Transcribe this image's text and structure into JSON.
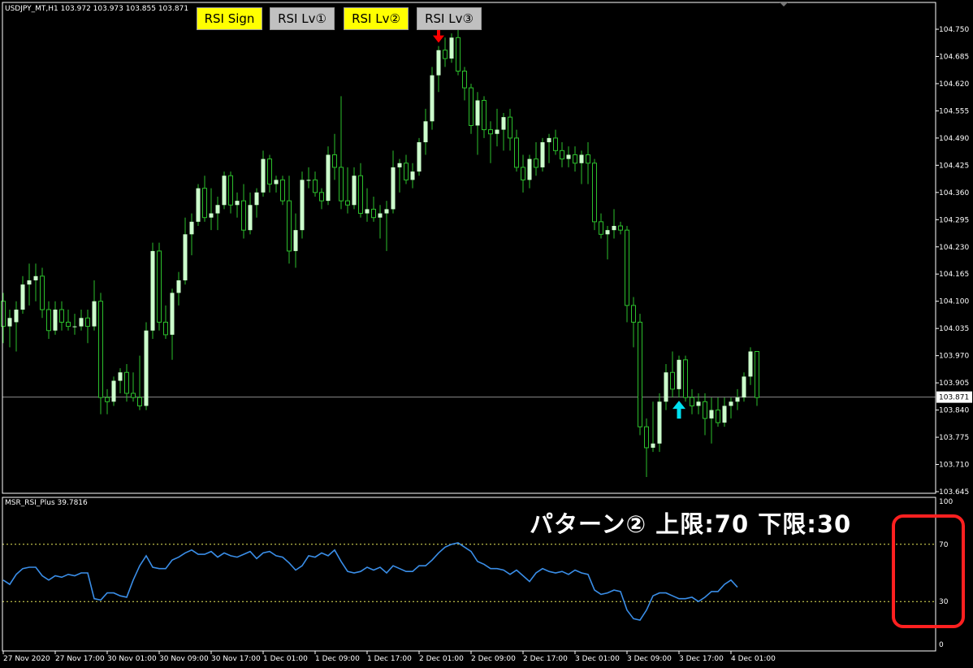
{
  "symbol_line": "USDJPY_MT,H1  103.972 103.973 103.855 103.871",
  "rsi_label": "MSR_RSI_Plus 39.7816",
  "pattern_text": "パターン②  上限:70  下限:30",
  "buttons": [
    {
      "label": "RSI Sign",
      "color": "#ffff00"
    },
    {
      "label": "RSI Lv①",
      "color": "#c0c0c0"
    },
    {
      "label": "RSI Lv②",
      "color": "#ffff00"
    },
    {
      "label": "RSI Lv③",
      "color": "#c0c0c0"
    }
  ],
  "colors": {
    "candle": "#ccffcc",
    "wick": "#2cc02c",
    "rsi_line": "#3a8ee8",
    "level_line": "#e8e85a",
    "down_arrow": "#ff0000",
    "up_arrow": "#00e0f0",
    "highlight_box": "#ff2020"
  },
  "chart_data": [
    {
      "type": "candlestick",
      "title": "USDJPY_MT,H1",
      "current_price": "103.871",
      "price_ticks": [
        "104.750",
        "104.685",
        "104.620",
        "104.555",
        "104.490",
        "104.425",
        "104.360",
        "104.295",
        "104.230",
        "104.165",
        "104.100",
        "104.035",
        "103.970",
        "103.905",
        "103.840",
        "103.775",
        "103.710",
        "103.645"
      ],
      "ylim": [
        103.645,
        104.75
      ],
      "ohlc": [
        [
          104.1,
          104.12,
          104.0,
          104.04
        ],
        [
          104.04,
          104.08,
          103.99,
          104.06
        ],
        [
          104.05,
          104.1,
          103.98,
          104.08
        ],
        [
          104.08,
          104.16,
          104.07,
          104.14
        ],
        [
          104.14,
          104.19,
          104.09,
          104.15
        ],
        [
          104.15,
          104.19,
          104.1,
          104.16
        ],
        [
          104.16,
          104.18,
          104.06,
          104.08
        ],
        [
          104.08,
          104.1,
          104.01,
          104.03
        ],
        [
          104.03,
          104.1,
          104.02,
          104.08
        ],
        [
          104.08,
          104.1,
          104.03,
          104.05
        ],
        [
          104.05,
          104.08,
          104.03,
          104.04
        ],
        [
          104.04,
          104.07,
          104.02,
          104.04
        ],
        [
          104.04,
          104.08,
          104.03,
          104.06
        ],
        [
          104.06,
          104.08,
          104.0,
          104.04
        ],
        [
          104.04,
          104.15,
          104.03,
          104.1
        ],
        [
          104.1,
          104.12,
          103.83,
          103.87
        ],
        [
          103.87,
          103.89,
          103.83,
          103.86
        ],
        [
          103.86,
          103.92,
          103.85,
          103.91
        ],
        [
          103.91,
          103.94,
          103.88,
          103.93
        ],
        [
          103.93,
          103.95,
          103.86,
          103.88
        ],
        [
          103.88,
          103.93,
          103.86,
          103.87
        ],
        [
          103.87,
          103.97,
          103.84,
          103.85
        ],
        [
          103.85,
          104.05,
          103.84,
          104.03
        ],
        [
          104.03,
          104.24,
          104.01,
          104.22
        ],
        [
          104.22,
          104.24,
          104.03,
          104.05
        ],
        [
          104.05,
          104.09,
          104.01,
          104.02
        ],
        [
          104.02,
          104.13,
          103.96,
          104.12
        ],
        [
          104.12,
          104.17,
          104.09,
          104.15
        ],
        [
          104.15,
          104.3,
          104.14,
          104.26
        ],
        [
          104.26,
          104.31,
          104.21,
          104.29
        ],
        [
          104.29,
          104.38,
          104.28,
          104.37
        ],
        [
          104.37,
          104.4,
          104.29,
          104.3
        ],
        [
          104.3,
          104.37,
          104.27,
          104.31
        ],
        [
          104.31,
          104.35,
          104.27,
          104.33
        ],
        [
          104.33,
          104.41,
          104.32,
          104.4
        ],
        [
          104.4,
          104.41,
          104.31,
          104.33
        ],
        [
          104.33,
          104.36,
          104.3,
          104.34
        ],
        [
          104.34,
          104.38,
          104.25,
          104.27
        ],
        [
          104.27,
          104.36,
          104.26,
          104.33
        ],
        [
          104.33,
          104.37,
          104.3,
          104.36
        ],
        [
          104.36,
          104.46,
          104.35,
          104.44
        ],
        [
          104.44,
          104.45,
          104.36,
          104.38
        ],
        [
          104.38,
          104.4,
          104.36,
          104.39
        ],
        [
          104.39,
          104.4,
          104.33,
          104.34
        ],
        [
          104.34,
          104.4,
          104.19,
          104.22
        ],
        [
          104.22,
          104.31,
          104.18,
          104.27
        ],
        [
          104.27,
          104.41,
          104.25,
          104.39
        ],
        [
          104.39,
          104.42,
          104.37,
          104.39
        ],
        [
          104.39,
          104.41,
          104.35,
          104.36
        ],
        [
          104.36,
          104.37,
          104.32,
          104.34
        ],
        [
          104.34,
          104.47,
          104.33,
          104.45
        ],
        [
          104.45,
          104.5,
          104.39,
          104.42
        ],
        [
          104.42,
          104.59,
          104.32,
          104.34
        ],
        [
          104.34,
          104.42,
          104.31,
          104.33
        ],
        [
          104.33,
          104.42,
          104.32,
          104.4
        ],
        [
          104.4,
          104.43,
          104.3,
          104.31
        ],
        [
          104.31,
          104.37,
          104.29,
          104.32
        ],
        [
          104.32,
          104.35,
          104.29,
          104.3
        ],
        [
          104.3,
          104.33,
          104.25,
          104.31
        ],
        [
          104.31,
          104.34,
          104.22,
          104.32
        ],
        [
          104.32,
          104.46,
          104.31,
          104.42
        ],
        [
          104.42,
          104.44,
          104.36,
          104.43
        ],
        [
          104.43,
          104.45,
          104.38,
          104.39
        ],
        [
          104.39,
          104.43,
          104.37,
          104.41
        ],
        [
          104.41,
          104.49,
          104.4,
          104.48
        ],
        [
          104.48,
          104.56,
          104.45,
          104.53
        ],
        [
          104.53,
          104.66,
          104.51,
          104.64
        ],
        [
          104.64,
          104.71,
          104.6,
          104.7
        ],
        [
          104.7,
          104.73,
          104.66,
          104.68
        ],
        [
          104.68,
          104.74,
          104.67,
          104.73
        ],
        [
          104.73,
          104.75,
          104.64,
          104.65
        ],
        [
          104.65,
          104.66,
          104.58,
          104.61
        ],
        [
          104.61,
          104.62,
          104.5,
          104.52
        ],
        [
          104.52,
          104.6,
          104.45,
          104.58
        ],
        [
          104.58,
          104.59,
          104.49,
          104.51
        ],
        [
          104.51,
          104.53,
          104.43,
          104.5
        ],
        [
          104.5,
          104.56,
          104.47,
          104.51
        ],
        [
          104.51,
          104.55,
          104.46,
          104.54
        ],
        [
          104.54,
          104.56,
          104.46,
          104.49
        ],
        [
          104.49,
          104.51,
          104.41,
          104.42
        ],
        [
          104.42,
          104.45,
          104.36,
          104.39
        ],
        [
          104.39,
          104.45,
          104.37,
          104.44
        ],
        [
          104.44,
          104.48,
          104.4,
          104.42
        ],
        [
          104.42,
          104.49,
          104.41,
          104.48
        ],
        [
          104.48,
          104.5,
          104.43,
          104.49
        ],
        [
          104.49,
          104.51,
          104.45,
          104.46
        ],
        [
          104.46,
          104.48,
          104.42,
          104.44
        ],
        [
          104.44,
          104.47,
          104.42,
          104.45
        ],
        [
          104.45,
          104.47,
          104.41,
          104.43
        ],
        [
          104.43,
          104.46,
          104.38,
          104.45
        ],
        [
          104.45,
          104.48,
          104.38,
          104.43
        ],
        [
          104.43,
          104.44,
          104.27,
          104.29
        ],
        [
          104.29,
          104.31,
          104.25,
          104.26
        ],
        [
          104.26,
          104.28,
          104.2,
          104.27
        ],
        [
          104.27,
          104.32,
          104.25,
          104.28
        ],
        [
          104.28,
          104.29,
          104.26,
          104.27
        ],
        [
          104.27,
          104.28,
          104.05,
          104.09
        ],
        [
          104.09,
          104.11,
          103.99,
          104.05
        ],
        [
          104.05,
          104.07,
          103.78,
          103.8
        ],
        [
          103.8,
          103.82,
          103.68,
          103.75
        ],
        [
          103.75,
          103.86,
          103.74,
          103.76
        ],
        [
          103.76,
          103.88,
          103.74,
          103.86
        ],
        [
          103.86,
          103.95,
          103.84,
          103.93
        ],
        [
          103.93,
          103.98,
          103.87,
          103.89
        ],
        [
          103.89,
          103.97,
          103.87,
          103.96
        ],
        [
          103.96,
          103.97,
          103.86,
          103.87
        ],
        [
          103.87,
          103.89,
          103.83,
          103.85
        ],
        [
          103.85,
          103.88,
          103.83,
          103.86
        ],
        [
          103.86,
          103.88,
          103.78,
          103.82
        ],
        [
          103.82,
          103.87,
          103.76,
          103.84
        ],
        [
          103.84,
          103.87,
          103.8,
          103.81
        ],
        [
          103.81,
          103.87,
          103.8,
          103.85
        ],
        [
          103.85,
          103.87,
          103.82,
          103.86
        ],
        [
          103.86,
          103.89,
          103.84,
          103.87
        ],
        [
          103.87,
          103.93,
          103.86,
          103.92
        ],
        [
          103.92,
          103.99,
          103.9,
          103.98
        ],
        [
          103.98,
          103.98,
          103.85,
          103.87
        ]
      ],
      "signals": [
        {
          "type": "down",
          "bar": 67
        },
        {
          "type": "down",
          "bar": 69
        },
        {
          "type": "up",
          "bar": 104
        }
      ],
      "x_ticks": [
        {
          "label": "27 Nov 2020",
          "bar": 0
        },
        {
          "label": "27 Nov 17:00",
          "bar": 8
        },
        {
          "label": "30 Nov 01:00",
          "bar": 16
        },
        {
          "label": "30 Nov 09:00",
          "bar": 24
        },
        {
          "label": "30 Nov 17:00",
          "bar": 32
        },
        {
          "label": "1 Dec 01:00",
          "bar": 40
        },
        {
          "label": "1 Dec 09:00",
          "bar": 48
        },
        {
          "label": "1 Dec 17:00",
          "bar": 56
        },
        {
          "label": "2 Dec 01:00",
          "bar": 64
        },
        {
          "label": "2 Dec 09:00",
          "bar": 72
        },
        {
          "label": "2 Dec 17:00",
          "bar": 80
        },
        {
          "label": "3 Dec 01:00",
          "bar": 88
        },
        {
          "label": "3 Dec 09:00",
          "bar": 96
        },
        {
          "label": "3 Dec 17:00",
          "bar": 104
        },
        {
          "label": "4 Dec 01:00",
          "bar": 112
        }
      ]
    },
    {
      "type": "line",
      "title": "MSR_RSI_Plus 39.7816",
      "y_ticks": [
        "100",
        "70",
        "30",
        "0"
      ],
      "ylim": [
        0,
        100
      ],
      "levels": [
        70,
        30
      ],
      "series": [
        {
          "name": "MSR_RSI_Plus",
          "values": [
            45,
            42,
            49,
            53,
            54,
            54,
            48,
            45,
            48,
            47,
            49,
            48,
            50,
            50,
            32,
            31,
            36,
            36,
            34,
            33,
            45,
            55,
            62,
            54,
            53,
            53,
            59,
            61,
            64,
            66,
            63,
            63,
            65,
            61,
            64,
            62,
            61,
            63,
            65,
            60,
            64,
            65,
            62,
            61,
            57,
            52,
            55,
            62,
            61,
            64,
            62,
            66,
            58,
            51,
            50,
            51,
            54,
            52,
            54,
            50,
            55,
            53,
            51,
            51,
            55,
            55,
            59,
            64,
            68,
            70,
            71,
            68,
            65,
            58,
            56,
            53,
            53,
            52,
            49,
            52,
            48,
            44,
            50,
            53,
            51,
            50,
            51,
            49,
            52,
            50,
            49,
            38,
            35,
            36,
            38,
            37,
            24,
            18,
            17,
            24,
            34,
            36,
            36,
            34,
            32,
            32,
            33,
            30,
            33,
            37,
            37,
            42,
            45,
            40
          ]
        }
      ]
    }
  ]
}
